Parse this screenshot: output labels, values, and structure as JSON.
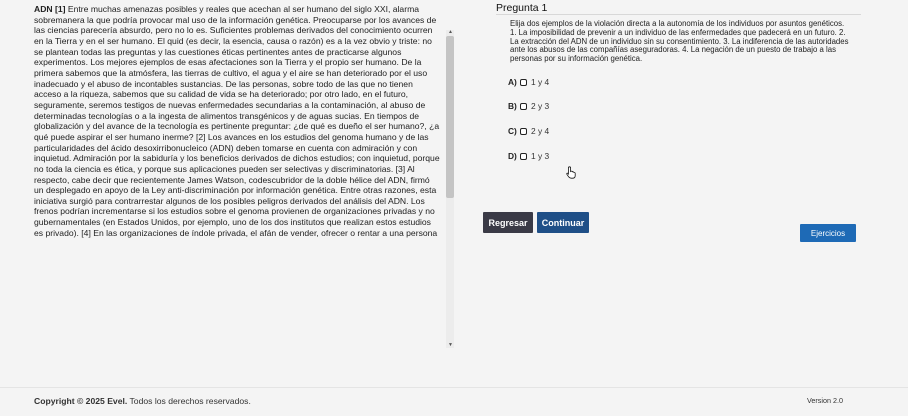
{
  "reading": {
    "ref_tag": "ADN [1]",
    "paragraph": " Entre muchas amenazas posibles y reales que acechan al ser humano del siglo XXI, alarma sobremanera la que podría provocar mal uso de la información genética. Preocuparse por los avances de las ciencias parecería absurdo, pero no lo es. Suficientes problemas derivados del conocimiento ocurren en la Tierra y en el ser humano. El quid (es decir, la esencia, causa o razón) es a la vez obvio y triste: no se plantean todas las preguntas y las cuestiones éticas pertinentes antes de practicarse algunos experimentos. Los mejores ejemplos de esas afectaciones son la Tierra y el propio ser humano. De la primera sabemos que la atmósfera, las tierras de cultivo, el agua y el aire se han deteriorado por el uso inadecuado y el abuso de incontables sustancias. De las personas, sobre todo de las que no tienen acceso a la riqueza, sabemos que su calidad de vida se ha deteriorado; por otro lado, en el futuro, seguramente, seremos testigos de nuevas enfermedades secundarias a la contaminación, al abuso de determinadas tecnologías o a la ingesta de alimentos transgénicos y de aguas sucias. En tiempos de globalización y del avance de la tecnología es pertinente preguntar: ¿de qué es dueño el ser humano?, ¿a qué puede aspirar el ser humano inerme? [2] Los avances en los estudios del genoma humano y de las particularidades del ácido desoxirribonucleico (ADN) deben tomarse en cuenta con admiración y con inquietud. Admiración por la sabiduría y los beneficios derivados de dichos estudios; con inquietud, porque no toda la ciencia es ética, y porque sus aplicaciones pueden ser selectivas y discriminatorias. [3] Al respecto, cabe decir que recientemente James Watson, codescubridor de la doble hélice del ADN, firmó un desplegado en apoyo de la Ley anti-discriminación por información genética. Entre otras razones, esta iniciativa surgió para contrarrestar algunos de los posibles peligros derivados del análisis del ADN. Los frenos podrían incrementarse si los estudios sobre el genoma provienen de organizaciones privadas y no gubernamentales (en Estados Unidos, por ejemplo, uno de los dos institutos que realizan estos estudios es privado). [4] En las organizaciones de índole privada, el afán de vender, ofrecer o rentar a una persona"
  },
  "question": {
    "title": "Pregunta 1",
    "instruction": "Elija dos ejemplos de la violación directa a la autonomía de los individuos por asuntos genéticos.",
    "statements": "1. La imposibilidad de prevenir a un individuo de las enfermedades que padecerá en un futuro. 2. La extracción del ADN de un individuo sin su consentimiento. 3. La indiferencia de las autoridades ante los abusos de las compañías aseguradoras. 4. La negación de un puesto de trabajo a las personas por su información genética.",
    "options": [
      {
        "letter": "A)",
        "text": "1 y 4"
      },
      {
        "letter": "B)",
        "text": "2 y 3"
      },
      {
        "letter": "C)",
        "text": "2 y 4"
      },
      {
        "letter": "D)",
        "text": "1 y 3"
      }
    ]
  },
  "buttons": {
    "back": "Regresar",
    "next": "Continuar",
    "exercises": "Ejercicios"
  },
  "footer": {
    "copyright_brand": "Copyright © 2025 Evel.",
    "copyright_rest": " Todos los derechos reservados.",
    "version": "Version 2.0"
  },
  "colors": {
    "back_button": "#3a3a46",
    "next_button": "#1f4f87",
    "exercises_button": "#1e6ab6"
  },
  "icons": [
    "scroll-up-arrow-icon",
    "scroll-down-arrow-icon",
    "hand-pointer-cursor-icon"
  ]
}
